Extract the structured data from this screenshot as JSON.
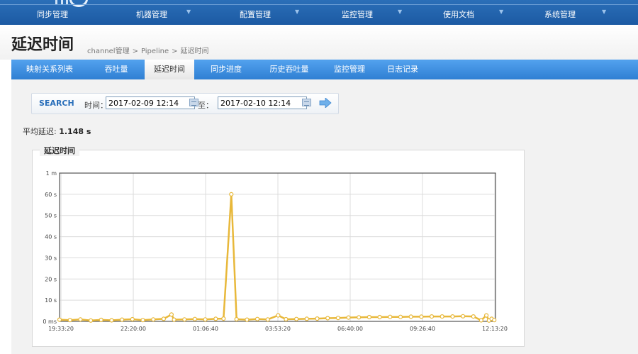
{
  "nav": {
    "items": [
      "同步管理",
      "机器管理",
      "配置管理",
      "监控管理",
      "使用文档",
      "系统管理"
    ],
    "dropdown_arrow": "▼"
  },
  "page": {
    "title": "延迟时间",
    "breadcrumb": [
      "channel管理",
      "Pipeline",
      "延迟时间"
    ],
    "breadcrumb_sep": ">"
  },
  "tabs": {
    "items": [
      "映射关系列表",
      "吞吐量",
      "延迟时间",
      "同步进度",
      "历史吞吐量",
      "监控管理",
      "日志记录"
    ],
    "active_index": 2
  },
  "search": {
    "button_label": "SEARCH",
    "time_label": "时间：",
    "start_value": "2017-02-09 12:14",
    "to_label": "至：",
    "end_value": "2017-02-10 12:14"
  },
  "summary": {
    "avg_label": "平均延迟:",
    "avg_value": "1.148 s"
  },
  "chart_data": {
    "type": "line",
    "legend_label": "延迟时间",
    "color": "#e8b83a",
    "y_ticks": [
      "0 ms",
      "10 s",
      "20 s",
      "30 s",
      "40 s",
      "50 s",
      "60 s",
      "1 m"
    ],
    "ylim": [
      0,
      70
    ],
    "x_ticks": [
      "19:33:20",
      "22:20:00",
      "01:06:40",
      "03:53:20",
      "06:40:00",
      "09:26:40",
      "12:13:20"
    ],
    "x_tick_values_h": [
      19.5556,
      22.3333,
      25.1111,
      27.8889,
      30.6667,
      33.4444,
      36.2222
    ],
    "xlim_h": [
      19.5,
      36.25
    ],
    "points": [
      [
        19.5,
        0.8
      ],
      [
        19.9,
        0.6
      ],
      [
        20.3,
        0.9
      ],
      [
        20.7,
        0.4
      ],
      [
        21.1,
        0.7
      ],
      [
        21.5,
        0.5
      ],
      [
        21.9,
        0.8
      ],
      [
        22.3,
        1.0
      ],
      [
        22.7,
        0.6
      ],
      [
        23.1,
        0.9
      ],
      [
        23.5,
        1.2
      ],
      [
        23.8,
        3.2
      ],
      [
        23.9,
        0.8
      ],
      [
        24.3,
        0.9
      ],
      [
        24.7,
        1.1
      ],
      [
        25.1,
        0.9
      ],
      [
        25.5,
        1.2
      ],
      [
        25.8,
        1.3
      ],
      [
        26.1,
        60.0
      ],
      [
        26.3,
        1.0
      ],
      [
        26.7,
        0.8
      ],
      [
        27.1,
        1.1
      ],
      [
        27.5,
        0.9
      ],
      [
        27.9,
        2.8
      ],
      [
        28.2,
        1.0
      ],
      [
        28.6,
        1.1
      ],
      [
        29.0,
        1.2
      ],
      [
        29.4,
        1.3
      ],
      [
        29.8,
        1.5
      ],
      [
        30.2,
        1.6
      ],
      [
        30.6,
        1.8
      ],
      [
        31.0,
        1.9
      ],
      [
        31.4,
        2.0
      ],
      [
        31.8,
        2.0
      ],
      [
        32.2,
        2.1
      ],
      [
        32.6,
        2.1
      ],
      [
        33.0,
        2.2
      ],
      [
        33.4,
        2.2
      ],
      [
        33.8,
        2.3
      ],
      [
        34.2,
        2.3
      ],
      [
        34.6,
        2.3
      ],
      [
        35.0,
        2.4
      ],
      [
        35.4,
        2.3
      ],
      [
        35.7,
        0.5
      ],
      [
        35.9,
        2.8
      ],
      [
        36.0,
        0.4
      ],
      [
        36.1,
        1.2
      ],
      [
        36.2,
        0.6
      ]
    ]
  }
}
